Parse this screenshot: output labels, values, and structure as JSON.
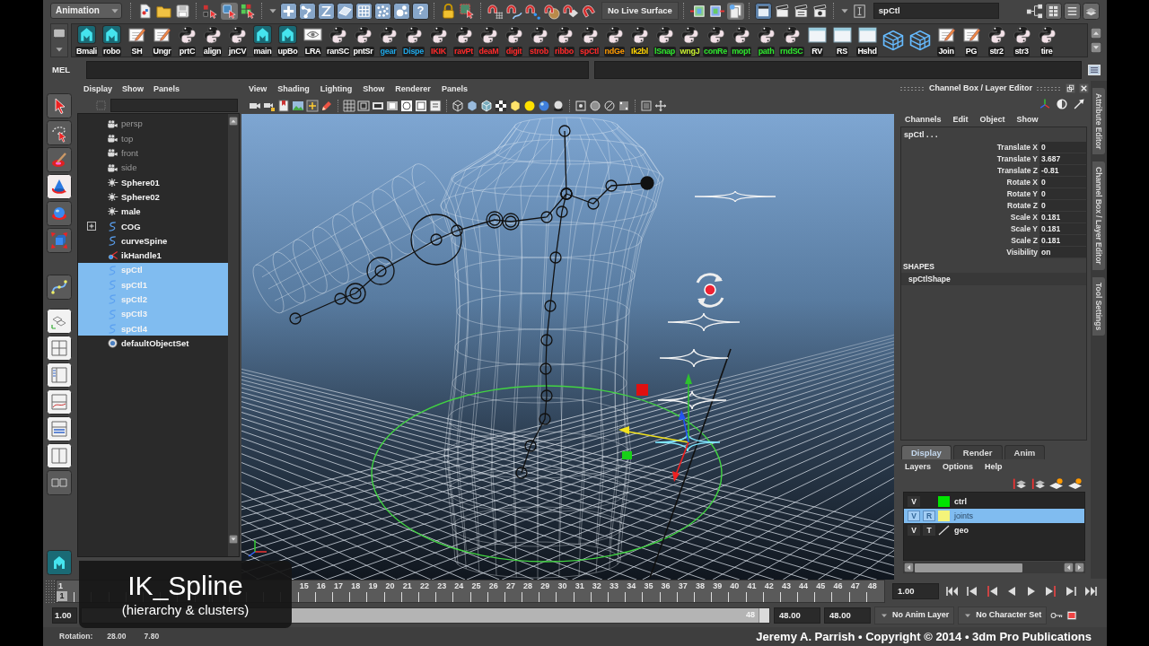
{
  "status_line": {
    "menu_set": "Animation",
    "select_by_object": true,
    "help_glyph": "?",
    "live_surface": "No Live Surface",
    "construction_history": true,
    "selection_field": "spCtl"
  },
  "shelf": {
    "buttons": [
      {
        "label": "Bmali",
        "kind": "maya",
        "color": "#ffffff"
      },
      {
        "label": "robo",
        "kind": "maya",
        "color": "#ffffff"
      },
      {
        "label": "SH",
        "kind": "note",
        "color": "#ffffff"
      },
      {
        "label": "Ungr",
        "kind": "note",
        "color": "#ffffff"
      },
      {
        "label": "prtC",
        "kind": "python",
        "color": "#ffffff"
      },
      {
        "label": "align",
        "kind": "python",
        "color": "#ffffff"
      },
      {
        "label": "jnCV",
        "kind": "python",
        "color": "#ffffff"
      },
      {
        "label": "main",
        "kind": "maya",
        "color": "#ffffff"
      },
      {
        "label": "upBo",
        "kind": "maya",
        "color": "#ffffff"
      },
      {
        "label": "LRA",
        "kind": "eye",
        "color": "#ffffff"
      },
      {
        "label": "ranSC",
        "kind": "python",
        "color": "#ffffff"
      },
      {
        "label": "pntSr",
        "kind": "python",
        "color": "#ffffff"
      },
      {
        "label": "gear",
        "kind": "python",
        "color": "#1fa8e8"
      },
      {
        "label": "Dispe",
        "kind": "python",
        "color": "#1fa8e8"
      },
      {
        "label": "IKIK",
        "kind": "python",
        "color": "#ff2a2a"
      },
      {
        "label": "ravPt",
        "kind": "python",
        "color": "#ff2a2a"
      },
      {
        "label": "deaM",
        "kind": "python",
        "color": "#ff2a2a"
      },
      {
        "label": "digit",
        "kind": "python",
        "color": "#ff2a2a"
      },
      {
        "label": "strob",
        "kind": "python",
        "color": "#ff2a2a"
      },
      {
        "label": "ribbo",
        "kind": "python",
        "color": "#ff2a2a"
      },
      {
        "label": "spCtl",
        "kind": "python",
        "color": "#ff2a2a"
      },
      {
        "label": "ndGe",
        "kind": "python",
        "color": "#ff9a00"
      },
      {
        "label": "Ik2bl",
        "kind": "python",
        "color": "#ffd400"
      },
      {
        "label": "lSnap",
        "kind": "python",
        "color": "#2ee82e"
      },
      {
        "label": "wngJ",
        "kind": "python",
        "color": "#c8f030"
      },
      {
        "label": "conRe",
        "kind": "python",
        "color": "#2ee82e"
      },
      {
        "label": "mopt",
        "kind": "python",
        "color": "#2ee82e"
      },
      {
        "label": "path",
        "kind": "python",
        "color": "#2ee82e"
      },
      {
        "label": "rndSC",
        "kind": "python",
        "color": "#2ee82e"
      },
      {
        "label": "RV",
        "kind": "window",
        "color": "#ffffff"
      },
      {
        "label": "RS",
        "kind": "window",
        "color": "#ffffff"
      },
      {
        "label": "Hshd",
        "kind": "window",
        "color": "#ffffff"
      },
      {
        "kind": "cube"
      },
      {
        "kind": "cube"
      },
      {
        "label": "Join",
        "kind": "note",
        "color": "#ffffff"
      },
      {
        "label": "PG",
        "kind": "note",
        "color": "#ffffff"
      },
      {
        "label": "str2",
        "kind": "python",
        "color": "#ffffff"
      },
      {
        "label": "str3",
        "kind": "python",
        "color": "#ffffff"
      },
      {
        "label": "tire",
        "kind": "python",
        "color": "#ffffff"
      }
    ]
  },
  "command_line": {
    "language": "MEL"
  },
  "toolbox": {
    "tools": [
      {
        "kind": "select",
        "selected": false
      },
      {
        "kind": "lasso",
        "selected": false
      },
      {
        "kind": "paint",
        "selected": false
      },
      {
        "kind": "move",
        "selected": true
      },
      {
        "kind": "rotate",
        "selected": false
      },
      {
        "kind": "scale",
        "selected": false
      }
    ],
    "layouts": [
      {
        "kind": "single"
      },
      {
        "kind": "four"
      },
      {
        "kind": "outliner"
      },
      {
        "kind": "graph"
      },
      {
        "kind": "stacked"
      },
      {
        "kind": "split"
      },
      {
        "kind": "pair"
      }
    ]
  },
  "outliner": {
    "menus": [
      "Display",
      "Show",
      "Panels"
    ],
    "items": [
      {
        "label": "persp",
        "kind": "camera",
        "selected": false
      },
      {
        "label": "top",
        "kind": "camera",
        "selected": false
      },
      {
        "label": "front",
        "kind": "camera",
        "selected": false
      },
      {
        "label": "side",
        "kind": "camera",
        "selected": false
      },
      {
        "label": "Sphere01",
        "kind": "transform",
        "selected": false
      },
      {
        "label": "Sphere02",
        "kind": "transform",
        "selected": false
      },
      {
        "label": "male",
        "kind": "transform",
        "selected": false
      },
      {
        "label": "COG",
        "kind": "curve",
        "selected": false,
        "expanded": false
      },
      {
        "label": "curveSpine",
        "kind": "curve",
        "selected": false
      },
      {
        "label": "ikHandle1",
        "kind": "ik",
        "selected": false
      },
      {
        "label": "spCtl",
        "kind": "curve",
        "selected": true
      },
      {
        "label": "spCtl1",
        "kind": "curve",
        "selected": true
      },
      {
        "label": "spCtl2",
        "kind": "curve",
        "selected": true
      },
      {
        "label": "spCtl3",
        "kind": "curve",
        "selected": true
      },
      {
        "label": "spCtl4",
        "kind": "curve",
        "selected": true
      },
      {
        "label": "defaultObjectSet",
        "kind": "set",
        "selected": false
      }
    ]
  },
  "viewport": {
    "menus": [
      "View",
      "Shading",
      "Lighting",
      "Show",
      "Renderer",
      "Panels"
    ]
  },
  "channel_box": {
    "title": "Channel Box / Layer Editor",
    "menus": [
      "Channels",
      "Edit",
      "Object",
      "Show"
    ],
    "node": "spCtl . . .",
    "channels": [
      {
        "name": "Translate X",
        "value": "0"
      },
      {
        "name": "Translate Y",
        "value": "3.687"
      },
      {
        "name": "Translate Z",
        "value": "-0.81"
      },
      {
        "name": "Rotate X",
        "value": "0"
      },
      {
        "name": "Rotate Y",
        "value": "0"
      },
      {
        "name": "Rotate Z",
        "value": "0"
      },
      {
        "name": "Scale X",
        "value": "0.181"
      },
      {
        "name": "Scale Y",
        "value": "0.181"
      },
      {
        "name": "Scale Z",
        "value": "0.181"
      },
      {
        "name": "Visibility",
        "value": "on"
      }
    ],
    "shapes_header": "SHAPES",
    "shapes": [
      "spCtlShape"
    ]
  },
  "layer_editor": {
    "tabs": [
      {
        "label": "Display",
        "selected": true
      },
      {
        "label": "Render",
        "selected": false
      },
      {
        "label": "Anim",
        "selected": false
      }
    ],
    "menus": [
      "Layers",
      "Options",
      "Help"
    ],
    "layers": [
      {
        "visibility": "V",
        "color": "#00e400",
        "name": "ctrl",
        "selected": false
      },
      {
        "visibility": "V",
        "display_type": "R",
        "color": "#f4f47a",
        "name": "joints",
        "selected": true
      },
      {
        "visibility": "V",
        "display_type": "T",
        "name": "geo",
        "selected": false
      }
    ]
  },
  "side_tabs": [
    "Attribute Editor",
    "Channel Box / Layer Editor",
    "Tool Settings"
  ],
  "time_slider": {
    "start_label": "1",
    "labels": [
      "15",
      "16",
      "17",
      "18",
      "19",
      "20",
      "21",
      "22",
      "23",
      "24",
      "25",
      "26",
      "27",
      "28",
      "29",
      "30",
      "31",
      "32",
      "33",
      "34",
      "35",
      "36",
      "37",
      "38",
      "39",
      "40",
      "41",
      "42",
      "43",
      "44",
      "45",
      "46",
      "47",
      "48"
    ],
    "level": 0,
    "current_frame": "1",
    "current_time": "1.00"
  },
  "range_slider": {
    "start": "1.00",
    "level": 1,
    "end_handle": "48",
    "playback_end": "48.00",
    "animation_end": "48.00",
    "anim_layer": "No Anim Layer",
    "character_set": "No Character Set"
  },
  "help_line": {
    "label": "Rotation:",
    "values": [
      "28.00",
      "7.80"
    ]
  },
  "credit": "Jeremy A. Parrish • Copyright © 2014 • 3dm Pro Publications",
  "caption": {
    "title": "IK_Spline",
    "subtitle": "(hierarchy & clusters)"
  }
}
